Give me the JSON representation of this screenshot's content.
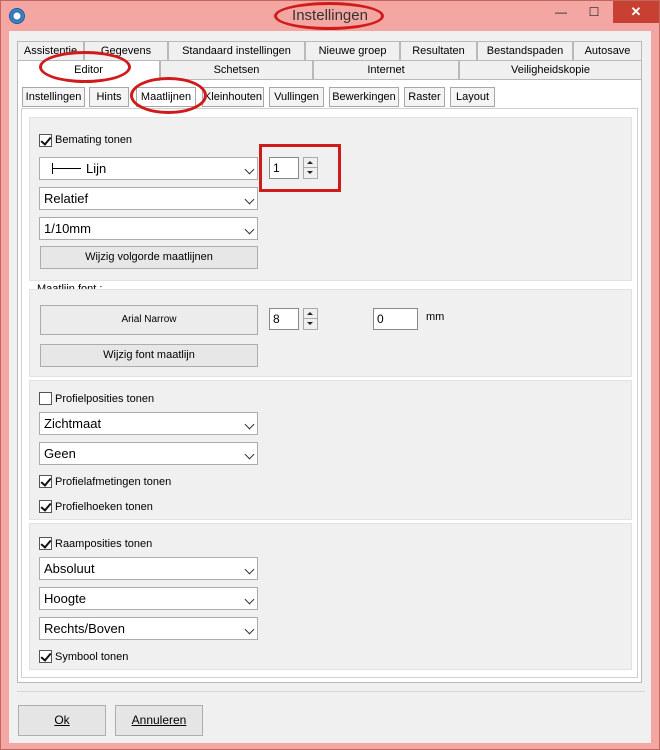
{
  "window": {
    "title": "Instellingen",
    "minimize_glyph": "—",
    "maximize_glyph": "☐",
    "close_glyph": "✕",
    "accent_color": "#d11a1a"
  },
  "tabs_row1": [
    "Assistentie",
    "Gegevens",
    "Standaard instellingen",
    "Nieuwe groep",
    "Resultaten",
    "Bestandspaden",
    "Autosave"
  ],
  "tabs_row2": [
    "Editor",
    "Schetsen",
    "Internet",
    "Veiligheidskopie"
  ],
  "subtabs": [
    "Instellingen",
    "Hints",
    "Maatlijnen",
    "Kleinhouten",
    "Vullingen",
    "Bewerkingen",
    "Raster",
    "Layout"
  ],
  "dimension": {
    "show_label": "Bemating tonen",
    "show_checked": true,
    "line_type": "Lijn",
    "line_count": "1",
    "mode": "Relatief",
    "unit": "1/10mm",
    "order_button": "Wijzig volgorde maatlijnen"
  },
  "font": {
    "group_label": "Maatlijn font :",
    "font_name": "Arial Narrow",
    "size": "8",
    "offset": "0",
    "offset_unit": "mm",
    "change_button": "Wijzig font maatlijn"
  },
  "profile": {
    "positions_label": "Profielposities tonen",
    "positions_checked": false,
    "sight_select": "Zichtmaat",
    "none_select": "Geen",
    "dims_label": "Profielafmetingen tonen",
    "dims_checked": true,
    "angles_label": "Profielhoeken tonen",
    "angles_checked": true
  },
  "frame": {
    "positions_label": "Raamposities tonen",
    "positions_checked": true,
    "abs_select": "Absoluut",
    "height_select": "Hoogte",
    "corner_select": "Rechts/Boven",
    "symbol_label": "Symbool tonen",
    "symbol_checked": true
  },
  "footer": {
    "ok": "Ok",
    "cancel": "Annuleren"
  }
}
